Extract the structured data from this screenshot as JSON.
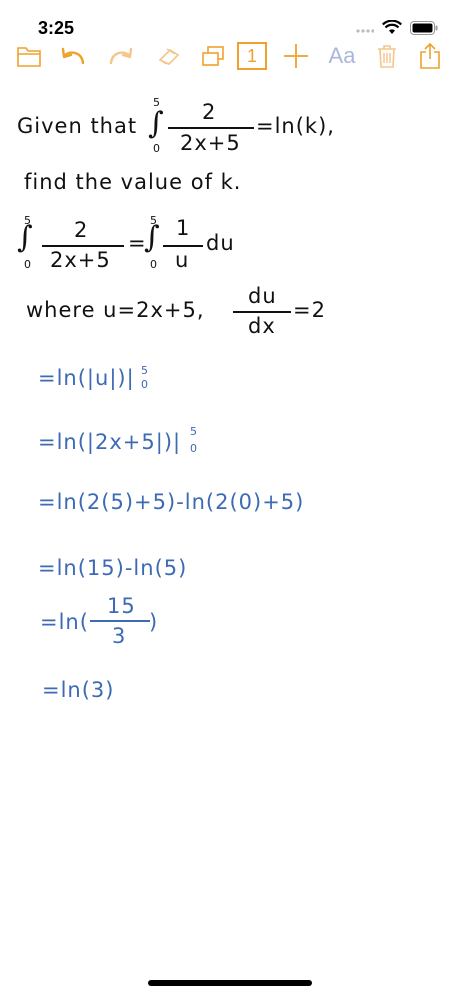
{
  "status": {
    "time": "3:25"
  },
  "toolbar": {
    "page_number": "1",
    "font_label": "Aa"
  },
  "problem": {
    "given_prefix": "Given that",
    "int1_upper": "5",
    "int1_lower": "0",
    "frac1_num": "2",
    "frac1_den": "2x+5",
    "equals_ln_k": "=ln(k),",
    "find_line": "find the value of k."
  },
  "step_sub": {
    "int_a_upper": "5",
    "int_a_lower": "0",
    "frac_a_num": "2",
    "frac_a_den": "2x+5",
    "eq": "=",
    "int_b_upper": "5",
    "int_b_lower": "0",
    "frac_b_num": "1",
    "frac_b_den": "u",
    "du": "du"
  },
  "where_line": {
    "text": "where u=2x+5,",
    "frac_num": "du",
    "frac_den": "dx",
    "eq2": "=2"
  },
  "steps": [
    {
      "text": "=ln(|u|)|",
      "upper": "5",
      "lower": "0"
    },
    {
      "text": "=ln(|2x+5|)|",
      "upper": "5",
      "lower": "0"
    },
    {
      "text": "=ln(2(5)+5)-ln(2(0)+5)"
    },
    {
      "text": "=ln(15)-ln(5)"
    },
    {
      "prefix": "=ln(",
      "num": "15",
      "den": "3",
      "suffix": ")"
    },
    {
      "text": "=ln(3)"
    }
  ],
  "colors": {
    "accent": "#f0a02d",
    "ink": "#111111",
    "blue_ink": "#3d6ab3",
    "muted_icon": "#aab7dd"
  }
}
